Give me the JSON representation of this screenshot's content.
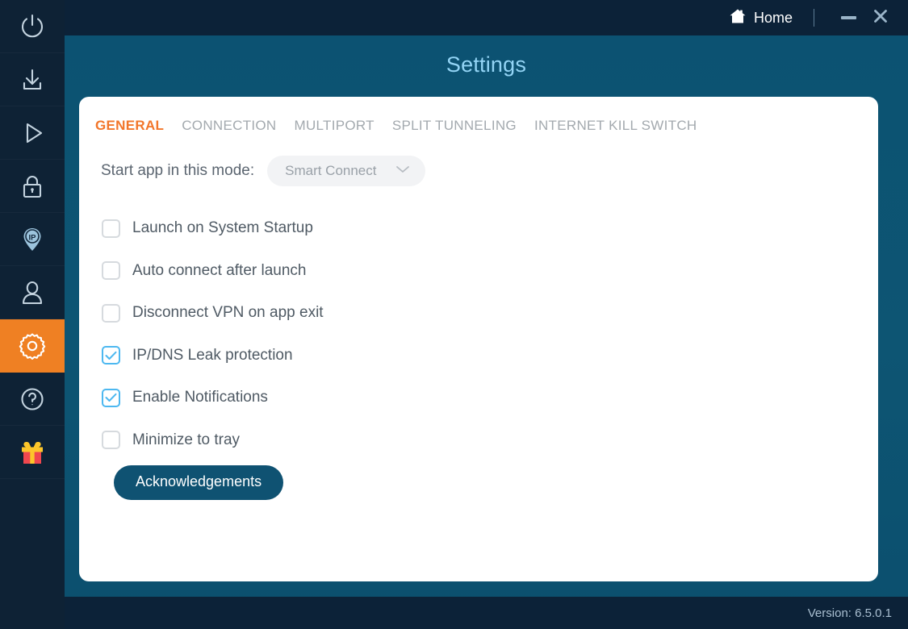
{
  "window": {
    "home_label": "Home",
    "home_icon": "house-icon",
    "minimize_icon": "minimize-icon",
    "close_icon": "close-icon",
    "titlebar_bg": "#0c2238"
  },
  "page": {
    "title": "Settings",
    "title_color": "#93d4f5",
    "background": "#0c5272"
  },
  "sidebar": {
    "background": "#0e2235",
    "active_color": "#ef8023",
    "items": [
      {
        "name": "power-icon",
        "label": "Power"
      },
      {
        "name": "download-icon",
        "label": "Download"
      },
      {
        "name": "play-icon",
        "label": "Play"
      },
      {
        "name": "lock-icon",
        "label": "Lock"
      },
      {
        "name": "ip-pin-icon",
        "label": "IP"
      },
      {
        "name": "user-icon",
        "label": "Account"
      },
      {
        "name": "gear-icon",
        "label": "Settings",
        "active": true
      },
      {
        "name": "help-icon",
        "label": "Help"
      },
      {
        "name": "gift-icon",
        "label": "Gift"
      }
    ]
  },
  "tabs": [
    {
      "label": "GENERAL",
      "active": true
    },
    {
      "label": "CONNECTION",
      "active": false
    },
    {
      "label": "MULTIPORT",
      "active": false
    },
    {
      "label": "SPLIT TUNNELING",
      "active": false
    },
    {
      "label": "INTERNET KILL SWITCH",
      "active": false
    }
  ],
  "tab_active_color": "#f2762a",
  "mode": {
    "label": "Start app in this mode:",
    "value": "Smart Connect",
    "chevron_icon": "chevron-down-icon"
  },
  "options": [
    {
      "label": "Launch on System Startup",
      "checked": false
    },
    {
      "label": "Auto connect after launch",
      "checked": false
    },
    {
      "label": "Disconnect VPN on app exit",
      "checked": false
    },
    {
      "label": "IP/DNS Leak protection",
      "checked": true
    },
    {
      "label": "Enable Notifications",
      "checked": true
    },
    {
      "label": "Minimize to tray",
      "checked": false
    }
  ],
  "checkbox_checked_color": "#4db8f0",
  "acknowledgements": {
    "label": "Acknowledgements",
    "background": "#0f5272"
  },
  "footer": {
    "version": "Version:  6.5.0.1"
  }
}
